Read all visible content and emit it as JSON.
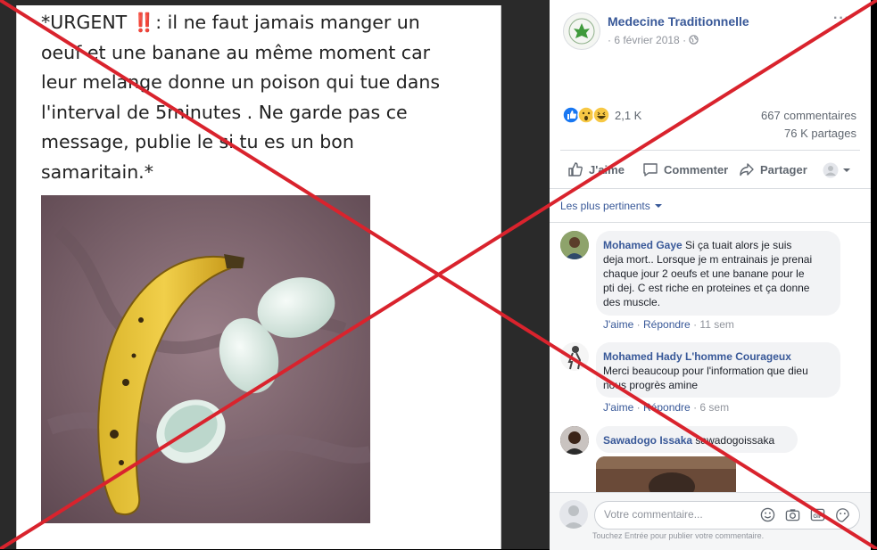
{
  "post": {
    "text": "*URGENT ‼️: il ne faut jamais manger un\noeuf et une banane au même moment car\nleur melange donne un poison qui tue dans\nl'interval  de 5minutes . Ne garde pas ce\nmessage, publie le si tu es un bon\nsamaritain.*"
  },
  "page": {
    "name": "Medecine Traditionnelle",
    "date": "6 février 2018",
    "separator": "·",
    "more": "···"
  },
  "stats": {
    "reactions": "2,1 K",
    "comments": "667 commentaires",
    "shares": "76 K partages"
  },
  "actions": {
    "like": "J'aime",
    "comment": "Commenter",
    "share": "Partager"
  },
  "filter": {
    "label": "Les plus pertinents"
  },
  "comments": [
    {
      "author": "Mohamed Gaye",
      "text_lines": [
        "Si ça tuait alors je suis",
        "deja mort.. Lorsque je m entrainais je prenai",
        "chaque jour 2 oeufs et une banane pour le",
        "pti dej. C est riche en proteines et ça donne",
        "des muscle."
      ],
      "like": "J'aime",
      "reply": "Répondre",
      "time": "11 sem"
    },
    {
      "author": "Mohamed Hady L'homme Courageux",
      "text_lines": [
        "Merci beaucoup pour l'information que dieu",
        "nous progrès amine"
      ],
      "like": "J'aime",
      "reply": "Répondre",
      "time": "6 sem"
    },
    {
      "author": "Sawadogo Issaka",
      "text_lines": [
        "sawadogoissaka"
      ]
    }
  ],
  "composer": {
    "placeholder": "Votre commentaire...",
    "hint": "Touchez Entrée pour publier votre commentaire."
  },
  "colors": {
    "fb_blue": "#385898",
    "cross_red": "#d9232d",
    "like_blue": "#1877f2"
  }
}
